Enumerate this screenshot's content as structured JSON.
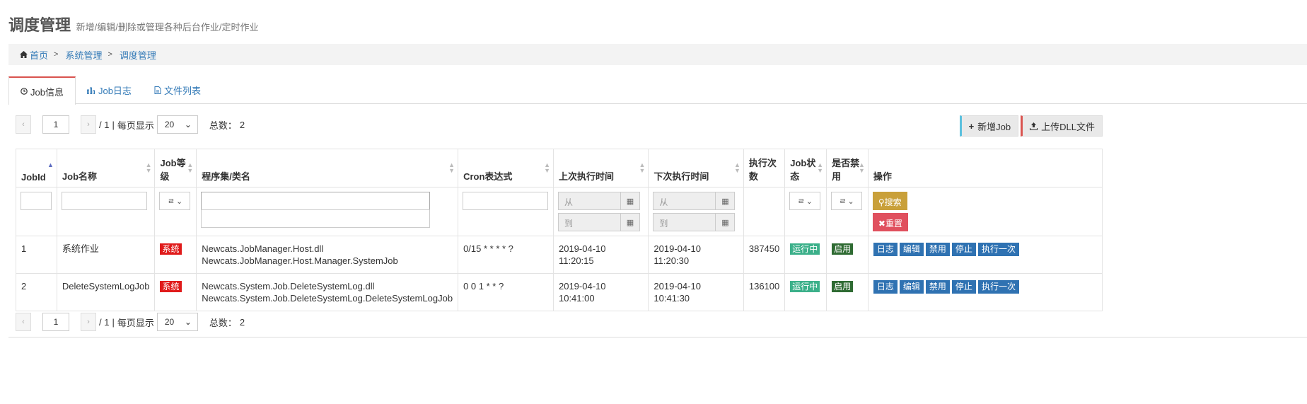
{
  "header": {
    "title": "调度管理",
    "subtitle": "新增/编辑/删除或管理各种后台作业/定时作业"
  },
  "breadcrumb": [
    "首页",
    "系统管理",
    "调度管理"
  ],
  "tabs": [
    "Job信息",
    "Job日志",
    "文件列表"
  ],
  "pager": {
    "page": "1",
    "total_pages": "/ 1",
    "sep": "|",
    "per_page_label": "每页显示",
    "per_page": "20",
    "total_label": "总数：",
    "total": "2"
  },
  "toolbar": {
    "add_label": "新增Job",
    "upload_label": "上传DLL文件"
  },
  "columns": [
    "JobId",
    "Job名称",
    "Job等级",
    "程序集/类名",
    "Cron表达式",
    "上次执行时间",
    "下次执行时间",
    "执行次数",
    "Job状态",
    "是否禁用",
    "操作"
  ],
  "filters": {
    "from": "从",
    "to": "到",
    "select_abbr": "ㄹ",
    "search": "搜索",
    "reset": "重置"
  },
  "rows": [
    {
      "id": "1",
      "name": "系统作业",
      "level": "系统",
      "assembly": "Newcats.JobManager.Host.dll",
      "class": "Newcats.JobManager.Host.Manager.SystemJob",
      "cron": "0/15 * * * * ?",
      "last": "2019-04-10 11:20:15",
      "next": "2019-04-10 11:20:30",
      "count": "387450",
      "status": "运行中",
      "disabled": "启用"
    },
    {
      "id": "2",
      "name": "DeleteSystemLogJob",
      "level": "系统",
      "assembly": "Newcats.System.Job.DeleteSystemLog.dll",
      "class": "Newcats.System.Job.DeleteSystemLog.DeleteSystemLogJob",
      "cron": "0 0 1 * * ?",
      "last": "2019-04-10 10:41:00",
      "next": "2019-04-10 10:41:30",
      "count": "136100",
      "status": "运行中",
      "disabled": "启用"
    }
  ],
  "actions": [
    "日志",
    "编辑",
    "禁用",
    "停止",
    "执行一次"
  ]
}
